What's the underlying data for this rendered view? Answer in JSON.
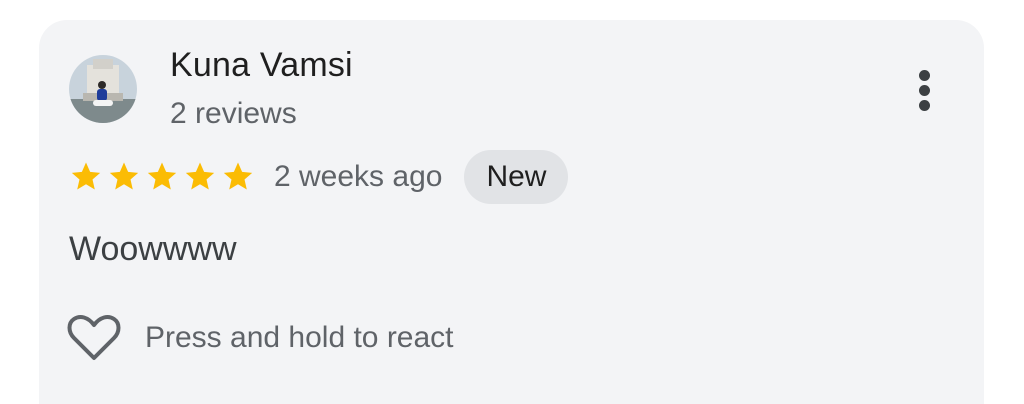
{
  "review": {
    "author_name": "Kuna Vamsi",
    "author_reviews": "2 reviews",
    "rating": 5,
    "rating_max": 5,
    "time_ago": "2 weeks ago",
    "badge": "New",
    "text": "Woowwww",
    "react_hint": "Press and hold to react"
  },
  "icons": {
    "avatar": "user-avatar-photo",
    "more": "more-vertical-icon",
    "star": "star-icon",
    "react": "heart-outline-icon"
  },
  "colors": {
    "card_background": "#f3f4f6",
    "star": "#fbbc04",
    "badge_background": "#e1e3e6",
    "primary_text": "#1f1f1f",
    "secondary_text": "#5f6368"
  }
}
